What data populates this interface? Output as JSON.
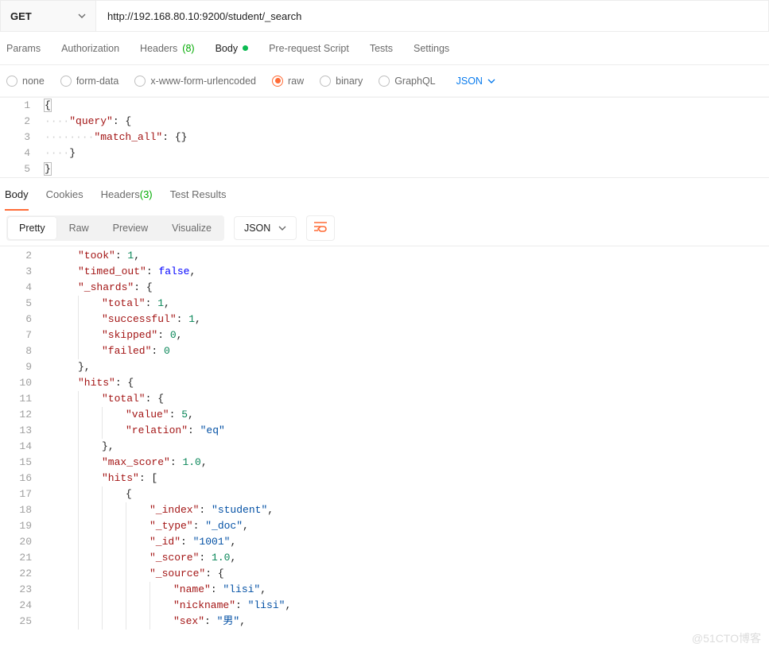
{
  "method": "GET",
  "url": "http://192.168.80.10:9200/student/_search",
  "request_tabs": {
    "params": "Params",
    "authorization": "Authorization",
    "headers_label": "Headers",
    "headers_count": "(8)",
    "body": "Body",
    "prerequest": "Pre-request Script",
    "tests": "Tests",
    "settings": "Settings"
  },
  "body_types": {
    "none": "none",
    "formdata": "form-data",
    "xwww": "x-www-form-urlencoded",
    "raw": "raw",
    "binary": "binary",
    "graphql": "GraphQL"
  },
  "raw_language": "JSON",
  "request_body_lines": [
    {
      "n": "1",
      "ws": "",
      "txt": [
        {
          "t": "{",
          "c": "tok-brace boxed"
        }
      ]
    },
    {
      "n": "2",
      "ws": "····",
      "txt": [
        {
          "t": "\"query\"",
          "c": "tok-key"
        },
        {
          "t": ": {",
          "c": "tok-punc"
        }
      ]
    },
    {
      "n": "3",
      "ws": "········",
      "txt": [
        {
          "t": "\"match_all\"",
          "c": "tok-key"
        },
        {
          "t": ": {}",
          "c": "tok-punc"
        }
      ]
    },
    {
      "n": "4",
      "ws": "····",
      "txt": [
        {
          "t": "}",
          "c": "tok-punc"
        }
      ]
    },
    {
      "n": "5",
      "ws": "",
      "txt": [
        {
          "t": "}",
          "c": "tok-brace boxed"
        }
      ]
    }
  ],
  "response_tabs": {
    "body": "Body",
    "cookies": "Cookies",
    "headers_label": "Headers",
    "headers_count": "(3)",
    "tests": "Test Results"
  },
  "view_modes": {
    "pretty": "Pretty",
    "raw": "Raw",
    "preview": "Preview",
    "visualize": "Visualize"
  },
  "response_format": "JSON",
  "response_lines": [
    {
      "n": "2",
      "i": 1,
      "seg": [
        {
          "t": "\"took\"",
          "c": "rk"
        },
        {
          "t": ": ",
          "c": "rp"
        },
        {
          "t": "1",
          "c": "rn"
        },
        {
          "t": ",",
          "c": "rp"
        }
      ]
    },
    {
      "n": "3",
      "i": 1,
      "seg": [
        {
          "t": "\"timed_out\"",
          "c": "rk"
        },
        {
          "t": ": ",
          "c": "rp"
        },
        {
          "t": "false",
          "c": "rb"
        },
        {
          "t": ",",
          "c": "rp"
        }
      ]
    },
    {
      "n": "4",
      "i": 1,
      "seg": [
        {
          "t": "\"_shards\"",
          "c": "rk"
        },
        {
          "t": ": {",
          "c": "rp"
        }
      ]
    },
    {
      "n": "5",
      "i": 2,
      "seg": [
        {
          "t": "\"total\"",
          "c": "rk"
        },
        {
          "t": ": ",
          "c": "rp"
        },
        {
          "t": "1",
          "c": "rn"
        },
        {
          "t": ",",
          "c": "rp"
        }
      ]
    },
    {
      "n": "6",
      "i": 2,
      "seg": [
        {
          "t": "\"successful\"",
          "c": "rk"
        },
        {
          "t": ": ",
          "c": "rp"
        },
        {
          "t": "1",
          "c": "rn"
        },
        {
          "t": ",",
          "c": "rp"
        }
      ]
    },
    {
      "n": "7",
      "i": 2,
      "seg": [
        {
          "t": "\"skipped\"",
          "c": "rk"
        },
        {
          "t": ": ",
          "c": "rp"
        },
        {
          "t": "0",
          "c": "rn"
        },
        {
          "t": ",",
          "c": "rp"
        }
      ]
    },
    {
      "n": "8",
      "i": 2,
      "seg": [
        {
          "t": "\"failed\"",
          "c": "rk"
        },
        {
          "t": ": ",
          "c": "rp"
        },
        {
          "t": "0",
          "c": "rn"
        }
      ]
    },
    {
      "n": "9",
      "i": 1,
      "seg": [
        {
          "t": "},",
          "c": "rp"
        }
      ]
    },
    {
      "n": "10",
      "i": 1,
      "seg": [
        {
          "t": "\"hits\"",
          "c": "rk"
        },
        {
          "t": ": {",
          "c": "rp"
        }
      ]
    },
    {
      "n": "11",
      "i": 2,
      "seg": [
        {
          "t": "\"total\"",
          "c": "rk"
        },
        {
          "t": ": {",
          "c": "rp"
        }
      ]
    },
    {
      "n": "12",
      "i": 3,
      "seg": [
        {
          "t": "\"value\"",
          "c": "rk"
        },
        {
          "t": ": ",
          "c": "rp"
        },
        {
          "t": "5",
          "c": "rn"
        },
        {
          "t": ",",
          "c": "rp"
        }
      ]
    },
    {
      "n": "13",
      "i": 3,
      "seg": [
        {
          "t": "\"relation\"",
          "c": "rk"
        },
        {
          "t": ": ",
          "c": "rp"
        },
        {
          "t": "\"eq\"",
          "c": "rs"
        }
      ]
    },
    {
      "n": "14",
      "i": 2,
      "seg": [
        {
          "t": "},",
          "c": "rp"
        }
      ]
    },
    {
      "n": "15",
      "i": 2,
      "seg": [
        {
          "t": "\"max_score\"",
          "c": "rk"
        },
        {
          "t": ": ",
          "c": "rp"
        },
        {
          "t": "1.0",
          "c": "rn"
        },
        {
          "t": ",",
          "c": "rp"
        }
      ]
    },
    {
      "n": "16",
      "i": 2,
      "seg": [
        {
          "t": "\"hits\"",
          "c": "rk"
        },
        {
          "t": ": [",
          "c": "rp"
        }
      ]
    },
    {
      "n": "17",
      "i": 3,
      "seg": [
        {
          "t": "{",
          "c": "rp"
        }
      ]
    },
    {
      "n": "18",
      "i": 4,
      "seg": [
        {
          "t": "\"_index\"",
          "c": "rk"
        },
        {
          "t": ": ",
          "c": "rp"
        },
        {
          "t": "\"student\"",
          "c": "rs"
        },
        {
          "t": ",",
          "c": "rp"
        }
      ]
    },
    {
      "n": "19",
      "i": 4,
      "seg": [
        {
          "t": "\"_type\"",
          "c": "rk"
        },
        {
          "t": ": ",
          "c": "rp"
        },
        {
          "t": "\"_doc\"",
          "c": "rs"
        },
        {
          "t": ",",
          "c": "rp"
        }
      ]
    },
    {
      "n": "20",
      "i": 4,
      "seg": [
        {
          "t": "\"_id\"",
          "c": "rk"
        },
        {
          "t": ": ",
          "c": "rp"
        },
        {
          "t": "\"1001\"",
          "c": "rs"
        },
        {
          "t": ",",
          "c": "rp"
        }
      ]
    },
    {
      "n": "21",
      "i": 4,
      "seg": [
        {
          "t": "\"_score\"",
          "c": "rk"
        },
        {
          "t": ": ",
          "c": "rp"
        },
        {
          "t": "1.0",
          "c": "rn"
        },
        {
          "t": ",",
          "c": "rp"
        }
      ]
    },
    {
      "n": "22",
      "i": 4,
      "seg": [
        {
          "t": "\"_source\"",
          "c": "rk"
        },
        {
          "t": ": {",
          "c": "rp"
        }
      ]
    },
    {
      "n": "23",
      "i": 5,
      "seg": [
        {
          "t": "\"name\"",
          "c": "rk"
        },
        {
          "t": ": ",
          "c": "rp"
        },
        {
          "t": "\"lisi\"",
          "c": "rs"
        },
        {
          "t": ",",
          "c": "rp"
        }
      ]
    },
    {
      "n": "24",
      "i": 5,
      "seg": [
        {
          "t": "\"nickname\"",
          "c": "rk"
        },
        {
          "t": ": ",
          "c": "rp"
        },
        {
          "t": "\"lisi\"",
          "c": "rs"
        },
        {
          "t": ",",
          "c": "rp"
        }
      ]
    },
    {
      "n": "25",
      "i": 5,
      "seg": [
        {
          "t": "\"sex\"",
          "c": "rk"
        },
        {
          "t": ": ",
          "c": "rp"
        },
        {
          "t": "\"男\"",
          "c": "rs"
        },
        {
          "t": ",",
          "c": "rp"
        }
      ]
    }
  ],
  "watermark": "@51CTO博客"
}
